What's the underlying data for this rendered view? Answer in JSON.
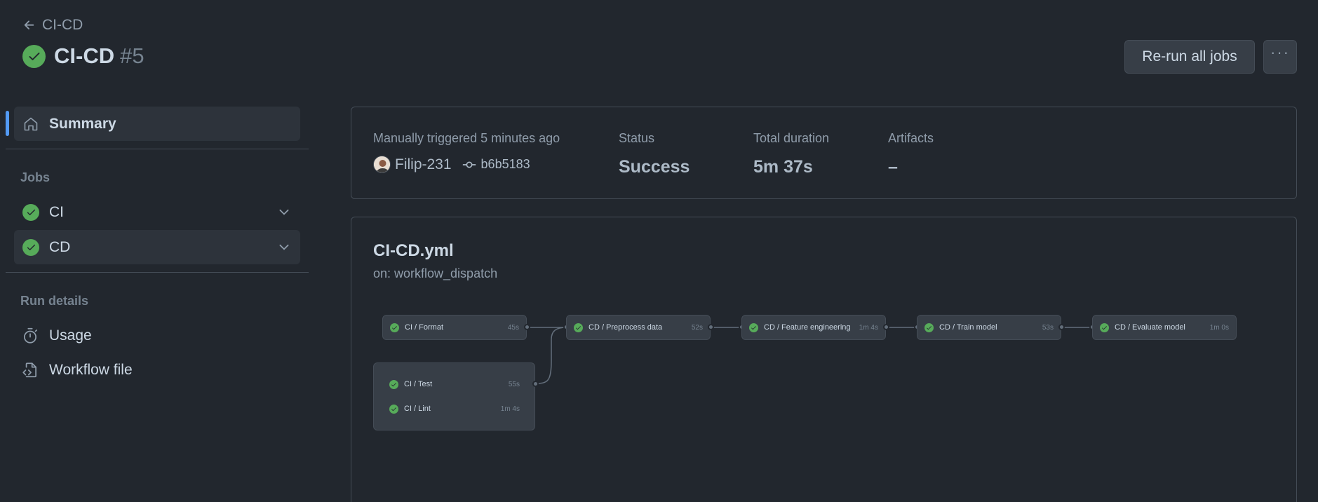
{
  "header": {
    "back_label": "CI-CD",
    "title": "CI-CD",
    "run_number": "#5",
    "rerun_label": "Re-run all jobs",
    "more_label": "···"
  },
  "sidebar": {
    "summary_label": "Summary",
    "jobs_heading": "Jobs",
    "jobs": [
      {
        "label": "CI",
        "status": "success"
      },
      {
        "label": "CD",
        "status": "success"
      }
    ],
    "run_details_heading": "Run details",
    "details": [
      {
        "label": "Usage",
        "icon": "stopwatch-icon"
      },
      {
        "label": "Workflow file",
        "icon": "file-code-icon"
      }
    ]
  },
  "summary": {
    "trigger_label": "Manually triggered 5 minutes ago",
    "actor": "Filip-231",
    "commit": "b6b5183",
    "status_label": "Status",
    "status_value": "Success",
    "duration_label": "Total duration",
    "duration_value": "5m 37s",
    "artifacts_label": "Artifacts",
    "artifacts_value": "–"
  },
  "workflow": {
    "file": "CI-CD.yml",
    "trigger": "on: workflow_dispatch",
    "jobs": {
      "format": {
        "name": "CI / Format",
        "duration": "45s"
      },
      "test": {
        "name": "CI / Test",
        "duration": "55s"
      },
      "lint": {
        "name": "CI / Lint",
        "duration": "1m 4s"
      },
      "preprocess": {
        "name": "CD / Preprocess data",
        "duration": "52s"
      },
      "feature": {
        "name": "CD / Feature engineering",
        "duration": "1m 4s"
      },
      "train": {
        "name": "CD / Train model",
        "duration": "53s"
      },
      "evaluate": {
        "name": "CD / Evaluate model",
        "duration": "1m 0s"
      }
    }
  },
  "colors": {
    "background": "#22272e",
    "success": "#57ab5a",
    "accent": "#539bf5",
    "border": "#444c56"
  }
}
